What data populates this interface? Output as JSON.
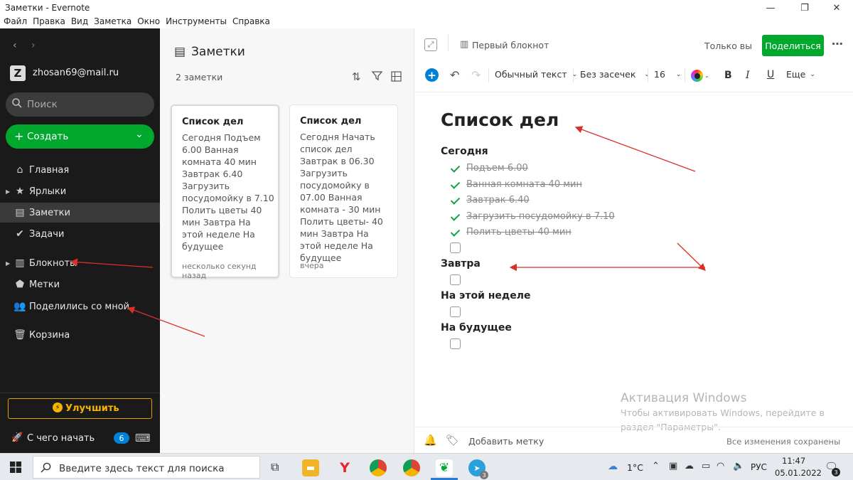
{
  "window": {
    "title": "Заметки - Evernote"
  },
  "menu": [
    "Файл",
    "Правка",
    "Вид",
    "Заметка",
    "Окно",
    "Инструменты",
    "Справка"
  ],
  "sidebar": {
    "account": "zhosan69@mail.ru",
    "avatar_letter": "Z",
    "search_placeholder": "Поиск",
    "create_label": "Создать",
    "items": [
      {
        "label": "Главная",
        "icon": "home-icon"
      },
      {
        "label": "Ярлыки",
        "icon": "star-icon"
      },
      {
        "label": "Заметки",
        "icon": "note-icon"
      },
      {
        "label": "Задачи",
        "icon": "check-circle-icon"
      },
      {
        "label": "Блокноты",
        "icon": "notebook-icon"
      },
      {
        "label": "Метки",
        "icon": "tag-icon"
      },
      {
        "label": "Поделились со мной",
        "icon": "people-icon"
      },
      {
        "label": "Корзина",
        "icon": "trash-icon"
      }
    ],
    "upgrade_label": "Улучшить",
    "getting_started": "С чего начать",
    "badge": "6",
    "accent": "#00a82d"
  },
  "notelist": {
    "title": "Заметки",
    "count": "2 заметки",
    "notes": [
      {
        "title": "Список дел",
        "body": "Сегодня Подъем 6.00 Ванная комната 40 мин Завтрак 6.40 Загрузить посудомойку в 7.10 Полить цветы 40 мин Завтра На этой неделе На будущее",
        "date": "несколько секунд назад"
      },
      {
        "title": "Список дел",
        "body": "Сегодня Начать список дел Завтрак в 06.30 Загрузить посудомойку в 07.00 Ванная комната - 30 мин Полить цветы- 40 мин Завтра На этой неделе На будущее",
        "date": "вчера"
      }
    ]
  },
  "editor": {
    "notebook": "Первый блокнот",
    "only_you": "Только вы",
    "share_label": "Поделиться",
    "toolbar": {
      "style": "Обычный текст",
      "font": "Без засечек",
      "size": "16",
      "more": "Еще"
    },
    "note_title": "Список дел",
    "sections": [
      {
        "heading": "Сегодня",
        "tasks": [
          "Подъем 6.00",
          "Ванная комната 40 мин",
          "Завтрак 6.40",
          "Загрузить посудомойку в 7.10",
          "Полить цветы 40 мин",
          ""
        ]
      },
      {
        "heading": "Завтра",
        "tasks": [
          ""
        ]
      },
      {
        "heading": "На этой неделе",
        "tasks": [
          ""
        ]
      },
      {
        "heading": "На будущее",
        "tasks": [
          ""
        ]
      }
    ],
    "add_tag": "Добавить метку",
    "saved": "Все изменения сохранены"
  },
  "watermark": {
    "title": "Активация Windows",
    "line1": "Чтобы активировать Windows, перейдите в",
    "line2": "раздел \"Параметры\"."
  },
  "taskbar": {
    "search_placeholder": "Введите здесь текст для поиска",
    "weather": "1°C",
    "lang": "РУС",
    "time": "11:47",
    "date": "05.01.2022",
    "notification_count": "3"
  }
}
